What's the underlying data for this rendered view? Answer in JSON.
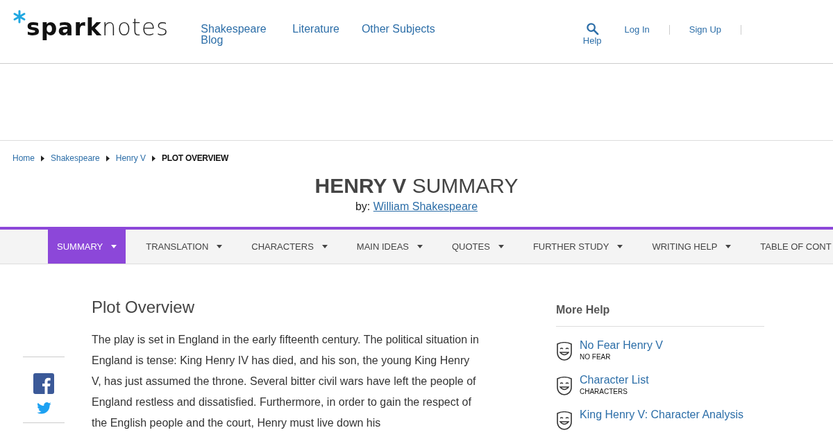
{
  "header": {
    "logo": {
      "bold": "spark",
      "light": "notes"
    },
    "nav": [
      "Shakespeare Blog",
      "Literature",
      "Other Subjects"
    ],
    "help": "Help",
    "account": [
      "Log In",
      "Sign Up"
    ]
  },
  "breadcrumb": {
    "links": [
      "Home",
      "Shakespeare",
      "Henry V"
    ],
    "current": "PLOT OVERVIEW"
  },
  "title": {
    "bold": "HENRY V",
    "light": "SUMMARY",
    "by_label": "by:",
    "author": "William Shakespeare"
  },
  "tabs": [
    {
      "label": "SUMMARY",
      "selected": true
    },
    {
      "label": "TRANSLATION",
      "selected": false
    },
    {
      "label": "CHARACTERS",
      "selected": false
    },
    {
      "label": "MAIN IDEAS",
      "selected": false
    },
    {
      "label": "QUOTES",
      "selected": false
    },
    {
      "label": "FURTHER STUDY",
      "selected": false
    },
    {
      "label": "WRITING HELP",
      "selected": false
    },
    {
      "label": "TABLE OF CONT",
      "selected": false,
      "cut": true
    }
  ],
  "article": {
    "heading": "Plot Overview",
    "paragraph": "The play is set in England in the early fifteenth century. The political situation in England is tense: King Henry IV has died, and his son, the young King Henry V, has just assumed the throne. Several bitter civil wars have left the people of England restless and dissatisfied. Furthermore, in order to gain the respect of the English people and the court, Henry must live down his"
  },
  "share": [
    {
      "kind": "facebook"
    },
    {
      "kind": "twitter"
    }
  ],
  "more_help": {
    "heading": "More Help",
    "items": [
      {
        "title": "No Fear Henry V",
        "category": "NO FEAR"
      },
      {
        "title": "Character List",
        "category": "CHARACTERS"
      },
      {
        "title": "King Henry V: Character Analysis"
      }
    ]
  }
}
